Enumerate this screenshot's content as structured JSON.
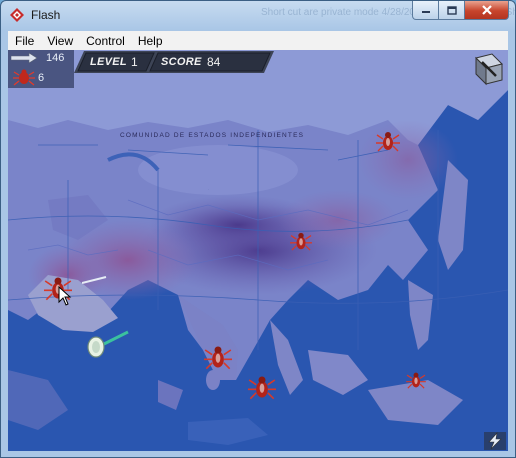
{
  "window": {
    "title": "Flash",
    "background_text": "Short cut are private mode   4/28/2014 1:48 PM   Internet Sh...",
    "controls": [
      "minimize-icon",
      "maximize-icon",
      "close-icon"
    ]
  },
  "menu": {
    "items": [
      {
        "label": "File"
      },
      {
        "label": "View"
      },
      {
        "label": "Control"
      },
      {
        "label": "Help"
      }
    ]
  },
  "hud": {
    "ammo_count": "146",
    "bugs_count": "6",
    "level_label": "LEVEL",
    "level_value": "1",
    "score_label": "SCORE",
    "score_value": "84"
  },
  "map": {
    "label_commonwealth": "COMUNIDAD DE ESTADOS INDEPENDIENTES"
  },
  "colors": {
    "ocean": "#2a56b0",
    "land_low": "#7a85c8",
    "land_high": "#5a4f9f",
    "bug_red": "#c0281c",
    "hud_dark": "#2a3040"
  }
}
